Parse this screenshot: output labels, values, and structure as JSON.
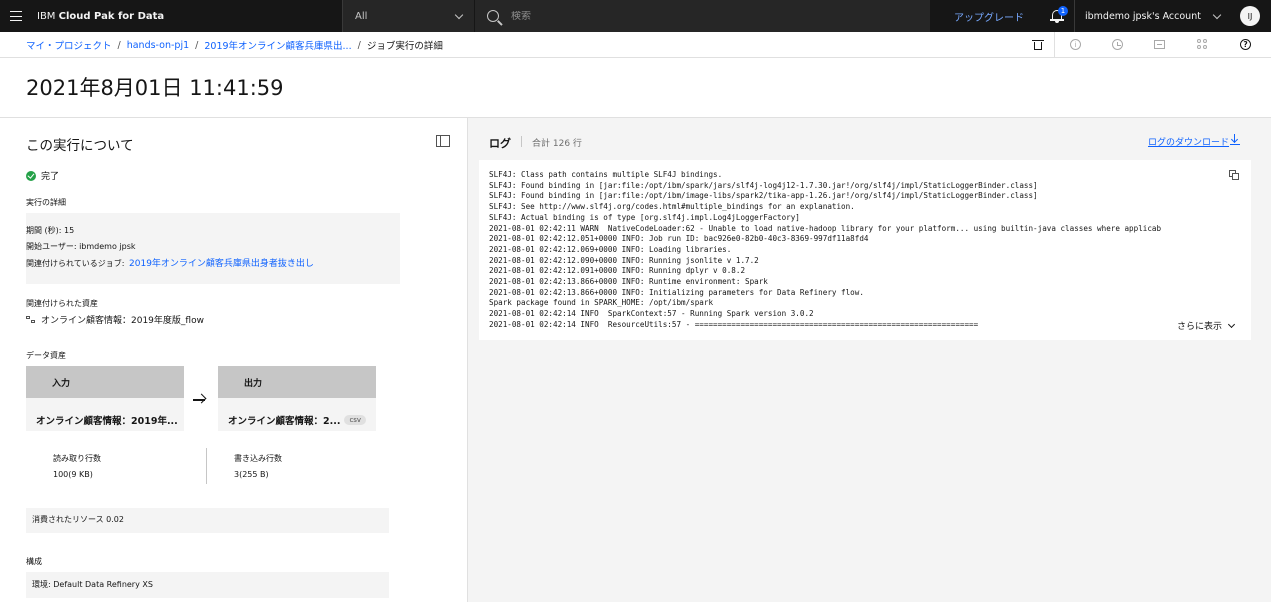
{
  "header": {
    "brand_prefix": "IBM ",
    "brand_bold": "Cloud Pak for Data",
    "scope": "All",
    "search_placeholder": "検索",
    "upgrade": "アップグレード",
    "notification_count": "1",
    "account": "ibmdemo jpsk's Account",
    "avatar_initials": "IJ"
  },
  "breadcrumb": {
    "items": [
      "マイ・プロジェクト",
      "hands-on-pj1",
      "2019年オンライン顧客兵庫県出..."
    ],
    "current": "ジョブ実行の詳細"
  },
  "page": {
    "title": "2021年8月01日 11:41:59"
  },
  "run": {
    "heading": "この実行について",
    "status": "完了",
    "details_label": "実行の詳細",
    "duration": "期間 (秒): 15",
    "started_by": "開始ユーザー:  ibmdemo jpsk",
    "related_job_label": "関連付けられているジョブ:",
    "related_job_link": "2019年オンライン顧客兵庫県出身者抜き出し",
    "assoc_label": "関連付けられた資産",
    "assoc_value": "オンライン顧客情報：2019年度版_flow",
    "data_assets_label": "データ資産",
    "input_header": "入力",
    "input_value": "オンライン顧客情報：2019年...",
    "output_header": "出力",
    "output_value": "オンライン顧客情報：2...",
    "output_tag": "csv",
    "rows_read_label": "読み取り行数",
    "rows_read_value": "100(9 KB)",
    "rows_written_label": "書き込み行数",
    "rows_written_value": "3(255 B)",
    "resources": "消費されたリソース   0.02",
    "config_label": "構成",
    "environment": "環境:   Default Data Refinery XS"
  },
  "log": {
    "title": "ログ",
    "count": "合計 126 行",
    "download": "ログのダウンロード",
    "show_more": "さらに表示",
    "lines": [
      "SLF4J: Class path contains multiple SLF4J bindings.",
      "SLF4J: Found binding in [jar:file:/opt/ibm/spark/jars/slf4j-log4j12-1.7.30.jar!/org/slf4j/impl/StaticLoggerBinder.class]",
      "SLF4J: Found binding in [jar:file:/opt/ibm/image-libs/spark2/tika-app-1.26.jar!/org/slf4j/impl/StaticLoggerBinder.class]",
      "SLF4J: See http://www.slf4j.org/codes.html#multiple_bindings for an explanation.",
      "SLF4J: Actual binding is of type [org.slf4j.impl.Log4jLoggerFactory]",
      "2021-08-01 02:42:11 WARN  NativeCodeLoader:62 - Unable to load native-hadoop library for your platform... using builtin-java classes where applicab",
      "2021-08-01 02:42:12.051+0000 INFO: Job run ID: bac926e0-82b0-40c3-8369-997df11a8fd4",
      "2021-08-01 02:42:12.069+0000 INFO: Loading libraries.",
      "2021-08-01 02:42:12.090+0000 INFO: Running jsonlite v 1.7.2",
      "2021-08-01 02:42:12.091+0000 INFO: Running dplyr v 0.8.2",
      "2021-08-01 02:42:13.866+0000 INFO: Runtime environment: Spark",
      "2021-08-01 02:42:13.866+0000 INFO: Initializing parameters for Data Refinery flow.",
      "Spark package found in SPARK_HOME: /opt/ibm/spark",
      "2021-08-01 02:42:14 INFO  SparkContext:57 - Running Spark version 3.0.2",
      "2021-08-01 02:42:14 INFO  ResourceUtils:57 - =============================================================="
    ]
  }
}
